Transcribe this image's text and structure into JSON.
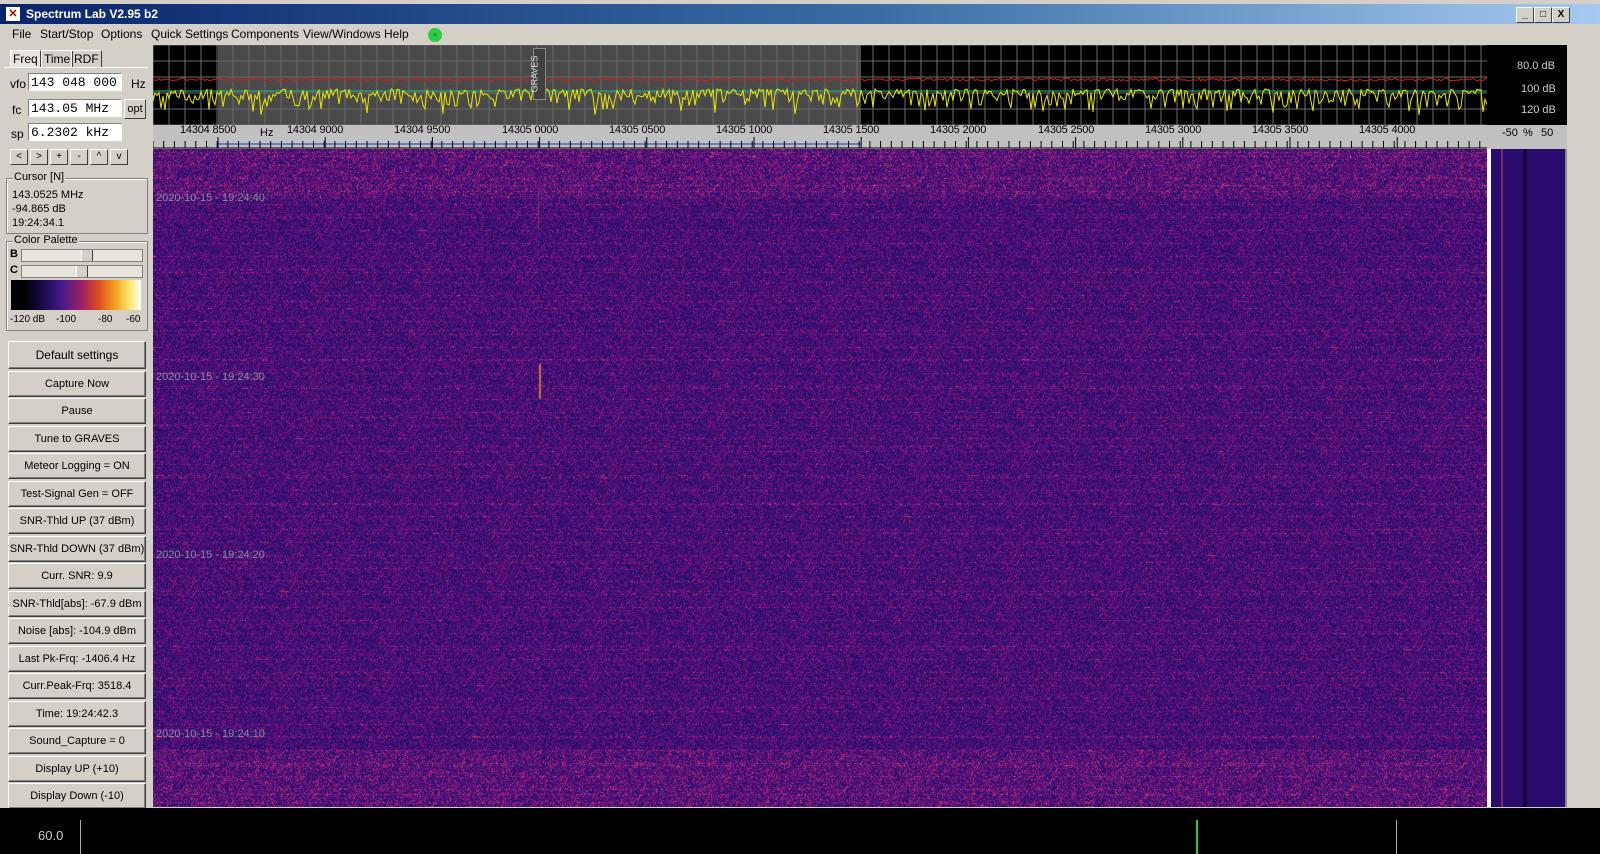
{
  "title": "Spectrum Lab V2.95 b2",
  "window_controls": {
    "minimize": "_",
    "maximize": "□",
    "close": "X"
  },
  "menu": [
    "File",
    "Start/Stop",
    "Options",
    "Quick Settings",
    "Components",
    "View/Windows",
    "Help"
  ],
  "tabs": [
    "Freq",
    "Time",
    "RDF"
  ],
  "vfo": {
    "label": "vfo",
    "value": "143 048 000",
    "unit": "Hz"
  },
  "fc": {
    "label": "fc",
    "value": "143.05 MHz",
    "opt": "opt"
  },
  "sp": {
    "label": "sp",
    "value": "6.2302 kHz"
  },
  "nav_buttons": [
    "<",
    ">",
    "+",
    "-",
    "^",
    "v"
  ],
  "cursor": {
    "title": "Cursor [N]",
    "freq": "143.0525 MHz",
    "level": "-94.865 dB",
    "time": "19:24:34.1"
  },
  "palette": {
    "title": "Color Palette",
    "b_label": "B",
    "c_label": "C",
    "b_level": 0.55,
    "c_level": 0.5,
    "ticks": [
      "-120 dB",
      "-100",
      "-80",
      "-60"
    ]
  },
  "buttons": [
    "Default settings",
    "Capture Now",
    "Pause",
    "Tune to GRAVES",
    "Meteor Logging = ON",
    "Test-Signal Gen = OFF",
    "SNR-Thld UP (37 dBm)",
    "SNR-Thld DOWN (37 dBm)",
    "Curr. SNR: 9.9",
    "SNR-Thld[abs]: -67.9 dBm",
    "Noise [abs]: -104.9 dBm",
    "Last Pk-Frq: -1406.4 Hz",
    "Curr.Peak-Frq: 3518.4",
    "Time:  19:24:42.3",
    "Sound_Capture = 0",
    "Display UP (+10)",
    "Display Down (-10)"
  ],
  "spectrum": {
    "db_labels": [
      "80.0 dB",
      "100 dB",
      "120 dB"
    ],
    "marker": "GRAVES"
  },
  "freq_scale": {
    "hz": "Hz",
    "labels": [
      "143048500",
      "143049000",
      "143049500",
      "143050000",
      "143050500",
      "143051000",
      "143051500",
      "143052000",
      "143052500",
      "143053000",
      "143053500",
      "143054000"
    ],
    "right_labels": [
      "-50",
      "%",
      "50"
    ]
  },
  "waterfall": {
    "timestamps": [
      "2020-10-15 - 19:24:40",
      "2020-10-15 - 19:24:30",
      "2020-10-15 - 19:24:20",
      "2020-10-15 - 19:24:10"
    ]
  },
  "bottom": {
    "value": "60.0"
  },
  "colors": {
    "spec_red": "#d02020",
    "spec_yellow": "#e8e800",
    "spec_green": "#20c080",
    "waterfall_bg": "#2a1470"
  }
}
